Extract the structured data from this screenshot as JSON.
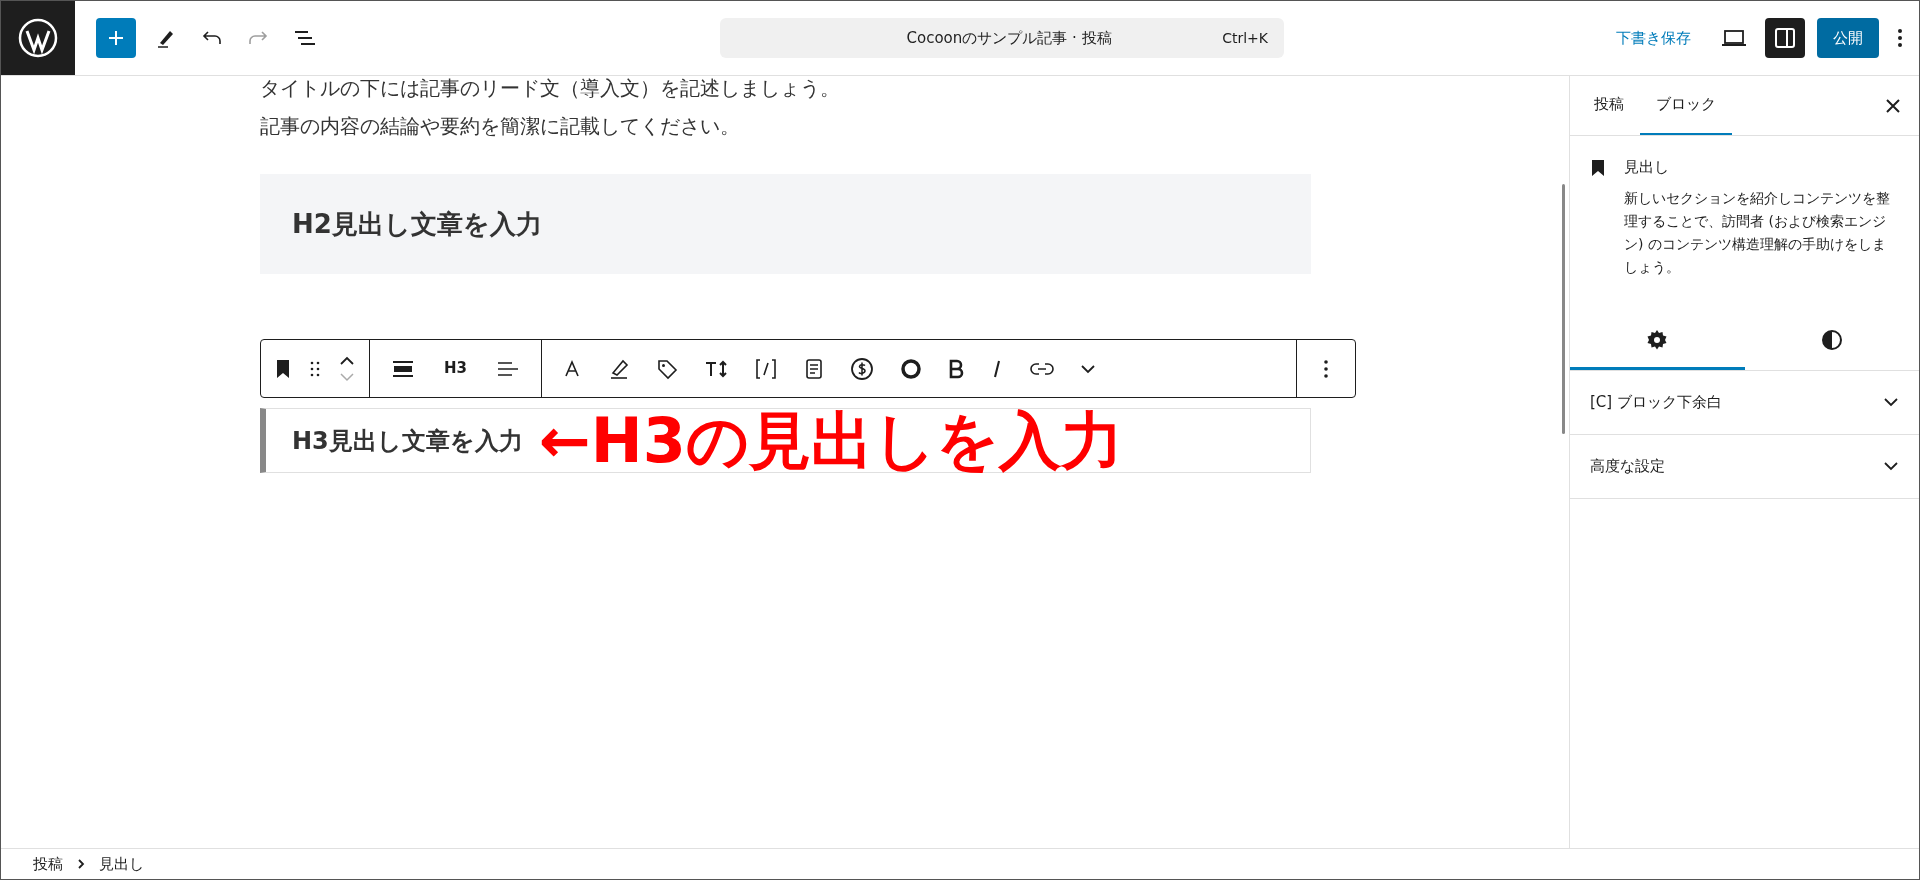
{
  "header": {
    "command_bar": {
      "title": "Cocoonのサンプル記事 · 投稿",
      "shortcut": "Ctrl+K"
    },
    "save_draft": "下書き保存",
    "settings_toggle": {
      "selected": true
    },
    "publish": "公開"
  },
  "editor": {
    "lead_lines": [
      "タイトルの下には記事のリード文（導入文）を記述しましょう。",
      "記事の内容の結論や要約を簡潔に記載してください。"
    ],
    "h2": "H2見出し文章を入力",
    "toolbar": {
      "heading_level": "H3"
    },
    "h3": "H3見出し文章を入力",
    "annotation": "←H3の見出しを入力"
  },
  "sidebar": {
    "tabs": [
      {
        "label": "投稿",
        "selected": false
      },
      {
        "label": "ブロック",
        "selected": true
      }
    ],
    "block_card": {
      "title": "見出し",
      "description": "新しいセクションを紹介しコンテンツを整理することで、訪問者 (および検索エンジン) のコンテンツ構造理解の手助けをしましょう。"
    },
    "sub_tabs": [
      {
        "kind": "settings",
        "selected": true
      },
      {
        "kind": "styles",
        "selected": false
      }
    ],
    "panels": [
      {
        "title": "[C] ブロック下余白",
        "expanded": false
      },
      {
        "title": "高度な設定",
        "expanded": false
      }
    ]
  },
  "breadcrumb": [
    "投稿",
    "見出し"
  ]
}
